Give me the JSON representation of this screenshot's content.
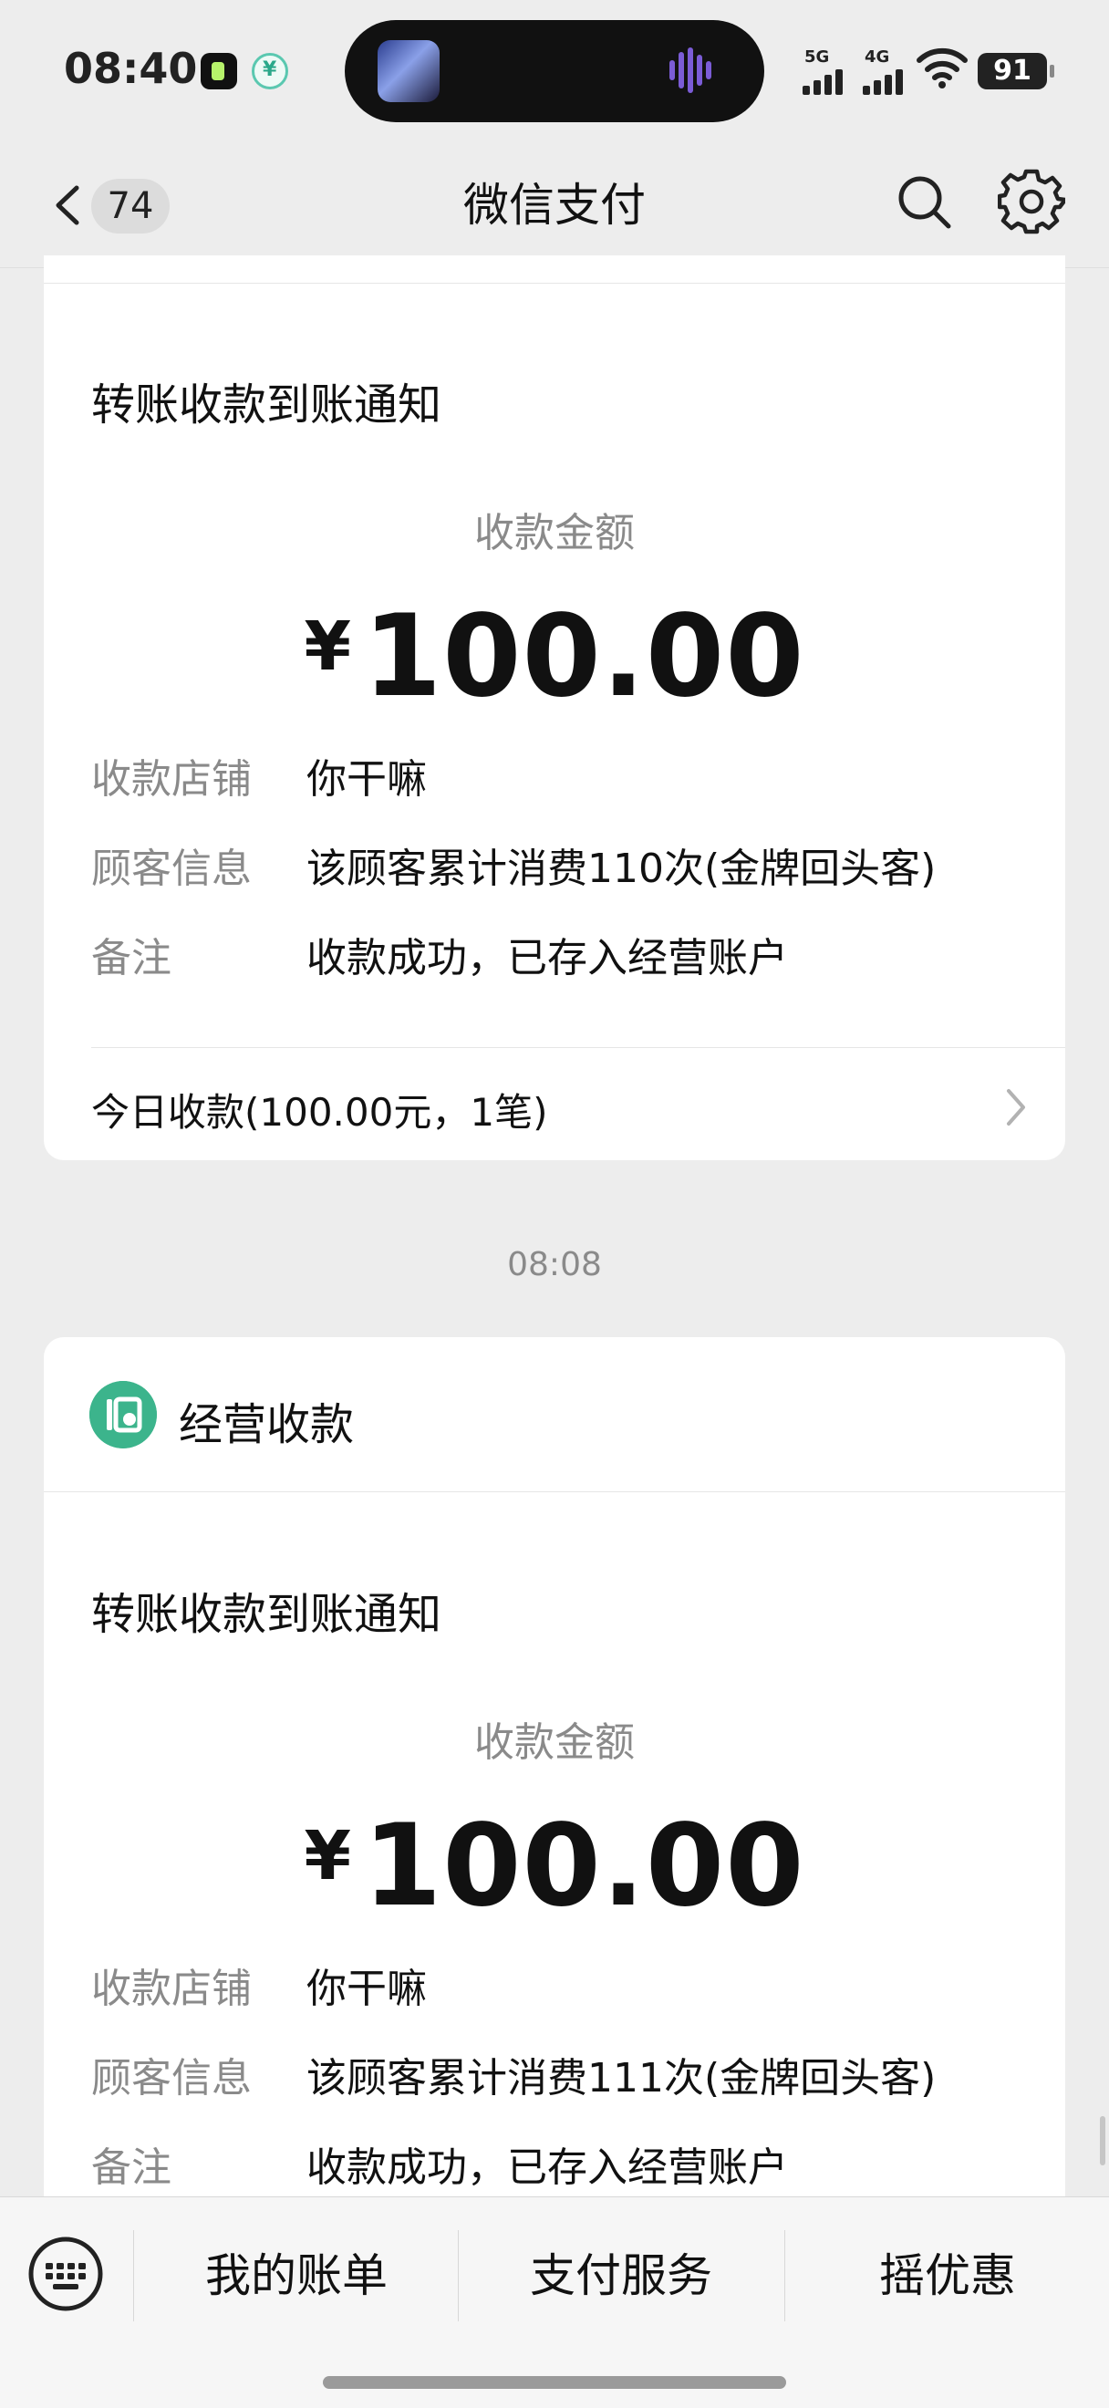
{
  "status_bar": {
    "time": "08:40",
    "signal_1": "5G",
    "signal_2": "4G",
    "battery": "91",
    "icons": [
      "music-app-icon",
      "pay-app-icon",
      "wifi-icon",
      "battery-icon"
    ]
  },
  "nav": {
    "unread_count": "74",
    "title": "微信支付",
    "icons": [
      "back-icon",
      "search-icon",
      "settings-icon"
    ]
  },
  "cards": [
    {
      "title": "转账收款到账通知",
      "amount_label": "收款金额",
      "currency": "¥",
      "amount": "100.00",
      "rows": [
        {
          "label": "收款店铺",
          "value": "你干嘛"
        },
        {
          "label": "顾客信息",
          "value": "该顾客累计消费110次(金牌回头客)"
        },
        {
          "label": "备注",
          "value": "收款成功，已存入经营账户"
        }
      ],
      "summary": "今日收款(100.00元，1笔)"
    },
    {
      "merchant": "经营收款",
      "title": "转账收款到账通知",
      "amount_label": "收款金额",
      "currency": "¥",
      "amount": "100.00",
      "rows": [
        {
          "label": "收款店铺",
          "value": "你干嘛"
        },
        {
          "label": "顾客信息",
          "value": "该顾客累计消费111次(金牌回头客)"
        },
        {
          "label": "备注",
          "value": "收款成功，已存入经营账户"
        }
      ]
    }
  ],
  "timestamp": "08:08",
  "bottom_menu": {
    "items": [
      "我的账单",
      "支付服务",
      "摇优惠"
    ]
  },
  "colors": {
    "background": "#ededed",
    "card": "#ffffff",
    "accent": "#3cb48c",
    "muted_text": "#8a8a8a"
  }
}
